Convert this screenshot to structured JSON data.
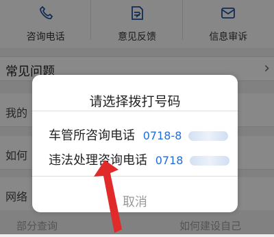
{
  "tabs": [
    {
      "label": "咨询电话",
      "icon": "phone-icon"
    },
    {
      "label": "意见反馈",
      "icon": "edit-icon"
    },
    {
      "label": "信息审诉",
      "icon": "mail-icon"
    }
  ],
  "faq": {
    "title": "常见问题"
  },
  "list_items": [
    {
      "label": "我的"
    },
    {
      "label": "如何"
    },
    {
      "label": "网络"
    }
  ],
  "dialog": {
    "title": "请选择拨打号码",
    "option1_label": "车管所咨询电话",
    "option1_phone": "0718-8",
    "option2_label": "违法处理咨询电话",
    "option2_phone": "0718",
    "cancel": "取消"
  },
  "ghost_text": {
    "left": "部分查询",
    "right": "如何建设自己"
  },
  "colors": {
    "link": "#1e6ddc",
    "overlay": "rgba(0,0,0,0.45)"
  }
}
